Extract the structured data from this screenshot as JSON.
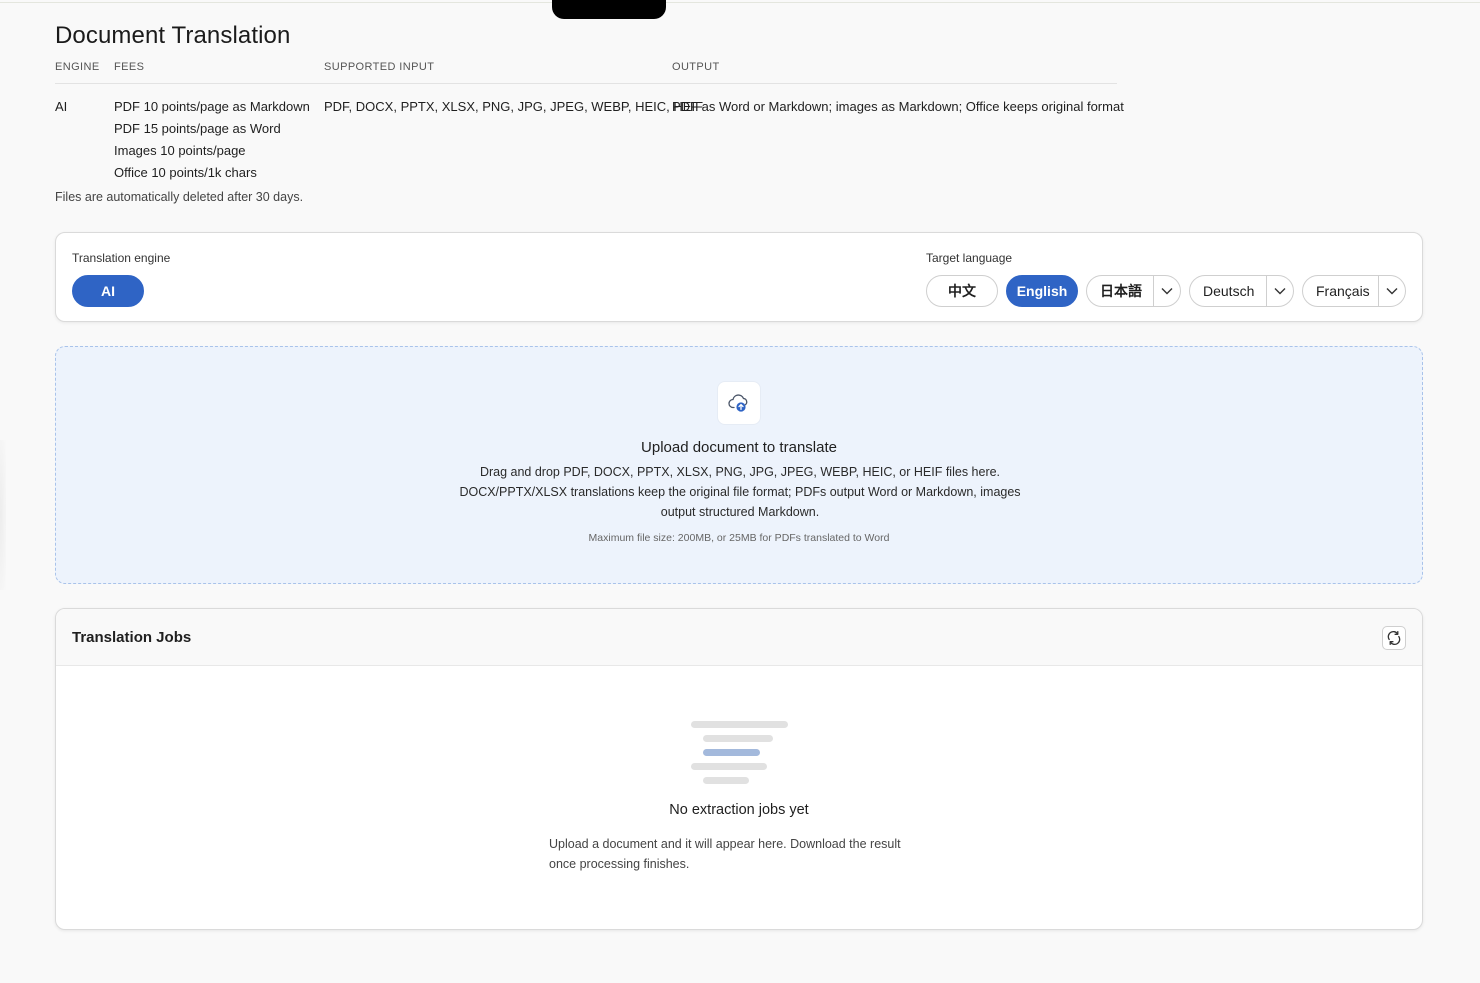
{
  "page": {
    "title": "Document Translation",
    "retention_note": "Files are automatically deleted after 30 days."
  },
  "info_table": {
    "headers": {
      "engine": "ENGINE",
      "fees": "FEES",
      "input": "SUPPORTED INPUT",
      "output": "OUTPUT"
    },
    "row": {
      "engine": "AI",
      "fees": [
        "PDF 10 points/page as Markdown",
        "PDF 15 points/page as Word",
        "Images 10 points/page",
        "Office 10 points/1k chars"
      ],
      "input": "PDF, DOCX, PPTX, XLSX, PNG, JPG, JPEG, WEBP, HEIC, HEIF",
      "output": "PDF as Word or Markdown; images as Markdown; Office keeps original format"
    }
  },
  "engine_panel": {
    "engine_label": "Translation engine",
    "engine_option": "AI",
    "target_label": "Target language",
    "languages": [
      {
        "label": "中文",
        "active": false,
        "dropdown": false
      },
      {
        "label": "English",
        "active": true,
        "dropdown": false
      },
      {
        "label": "日本語",
        "active": false,
        "dropdown": true
      },
      {
        "label": "Deutsch",
        "active": false,
        "dropdown": true
      },
      {
        "label": "Français",
        "active": false,
        "dropdown": true
      }
    ]
  },
  "upload": {
    "title": "Upload document to translate",
    "description_line1": "Drag and drop PDF, DOCX, PPTX, XLSX, PNG, JPG, JPEG, WEBP, HEIC, or HEIF files here.",
    "description_line2": "DOCX/PPTX/XLSX translations keep the original file format; PDFs output Word or Markdown, images output structured Markdown.",
    "limit": "Maximum file size: 200MB, or 25MB for PDFs translated to Word"
  },
  "jobs": {
    "title": "Translation Jobs",
    "empty_title": "No extraction jobs yet",
    "empty_desc": "Upload a document and it will appear here. Download the result once processing finishes."
  },
  "colors": {
    "accent": "#2f64c5",
    "upload_bg": "#edf3fc",
    "upload_border": "#a9c3ea",
    "illustration_highlight": "#a3b9dc"
  }
}
